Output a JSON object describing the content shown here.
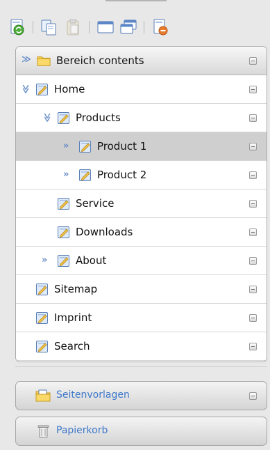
{
  "toolbar": {
    "buttons": [
      {
        "icon": "refresh-page-icon"
      },
      {
        "icon": "copy-icon"
      },
      {
        "icon": "paste-icon"
      },
      {
        "icon": "window-icon"
      },
      {
        "icon": "windows-icon"
      },
      {
        "icon": "delete-page-icon"
      }
    ]
  },
  "tree": {
    "root_label": "Bereich contents",
    "items": [
      {
        "label": "Home",
        "depth": 0,
        "expanded": true
      },
      {
        "label": "Products",
        "depth": 1,
        "expanded": true
      },
      {
        "label": "Product 1",
        "depth": 2,
        "expanded": false,
        "selected": true
      },
      {
        "label": "Product 2",
        "depth": 2,
        "expanded": false
      },
      {
        "label": "Service",
        "depth": 1
      },
      {
        "label": "Downloads",
        "depth": 1
      },
      {
        "label": "About",
        "depth": 1,
        "expanded": false
      },
      {
        "label": "Sitemap",
        "depth": 0
      },
      {
        "label": "Imprint",
        "depth": 0
      },
      {
        "label": "Search",
        "depth": 0
      }
    ]
  },
  "panels": {
    "templates_label": "Seitenvorlagen",
    "trash_label": "Papierkorb"
  },
  "colors": {
    "link_blue": "#3f78c9",
    "chevron_blue": "#6a8fc9",
    "selected_row": "#cfcfcf"
  }
}
